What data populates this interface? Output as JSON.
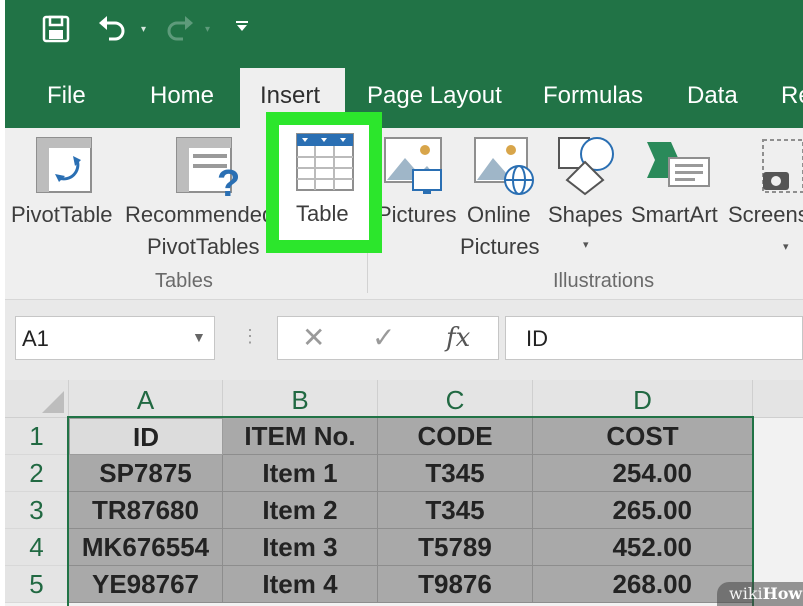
{
  "quick_access": {
    "save_icon": "save-icon",
    "undo_icon": "undo-icon",
    "redo_icon": "redo-icon",
    "customize_icon": "customize-caret-icon"
  },
  "tabs": [
    {
      "label": "File"
    },
    {
      "label": "Home"
    },
    {
      "label": "Insert"
    },
    {
      "label": "Page Layout"
    },
    {
      "label": "Formulas"
    },
    {
      "label": "Data"
    },
    {
      "label": "Re"
    }
  ],
  "active_tab": "Insert",
  "ribbon": {
    "tables": {
      "group_label": "Tables",
      "pivottable": "PivotTable",
      "recommended_line1": "Recommended",
      "recommended_line2": "PivotTables",
      "table": "Table"
    },
    "illustrations": {
      "group_label": "Illustrations",
      "pictures": "Pictures",
      "online_line1": "Online",
      "online_line2": "Pictures",
      "shapes": "Shapes",
      "smartart": "SmartArt",
      "screenshot": "Screens"
    }
  },
  "highlight_color": "#2ce62c",
  "formula_bar": {
    "name_box": "A1",
    "cancel": "✕",
    "enter": "✓",
    "fx": "fx",
    "value": "ID"
  },
  "sheet": {
    "columns": [
      "A",
      "B",
      "C",
      "D"
    ],
    "rows": [
      "1",
      "2",
      "3",
      "4",
      "5"
    ],
    "data": [
      [
        "ID",
        "ITEM No.",
        "CODE",
        "COST"
      ],
      [
        "SP7875",
        "Item 1",
        "T345",
        "254.00"
      ],
      [
        "TR87680",
        "Item 2",
        "T345",
        "265.00"
      ],
      [
        "MK676554",
        "Item 3",
        "T5789",
        "452.00"
      ],
      [
        "YE98767",
        "Item 4",
        "T9876",
        "268.00"
      ]
    ]
  },
  "watermark": {
    "prefix": "wiki",
    "suffix": "How"
  },
  "colors": {
    "excel_green": "#217346",
    "ribbon_bg": "#efefef"
  }
}
